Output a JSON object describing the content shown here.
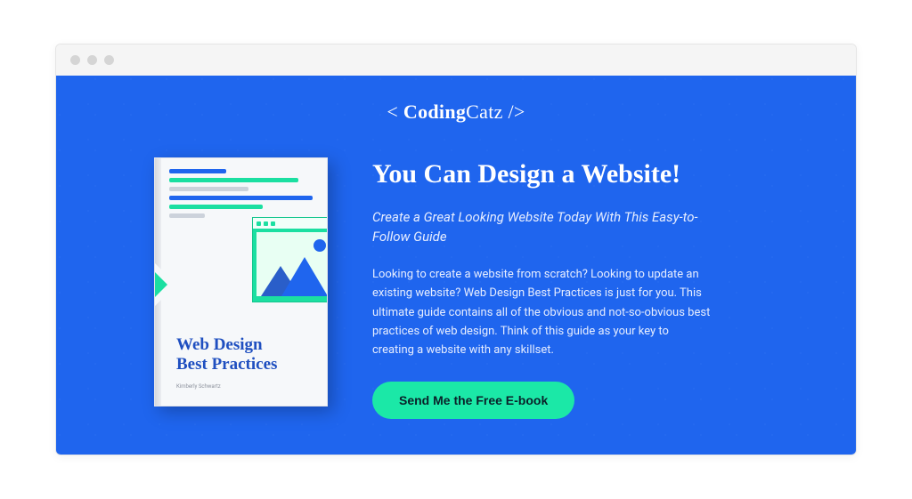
{
  "brand": {
    "prefix": "<",
    "name1": "Coding",
    "name2": "Catz",
    "suffix": "/>"
  },
  "book": {
    "title_line1": "Web Design",
    "title_line2": "Best Practices",
    "author": "Kimberly Schwartz"
  },
  "hero": {
    "headline": "You Can Design a Website!",
    "subhead": "Create a Great Looking Website Today With This Easy-to-Follow Guide",
    "body": "Looking to create a website from scratch? Looking to update an existing website? Web Design Best Practices is just for you. This ultimate guide contains all of the obvious and not-so-obvious best practices of web design. Think of this guide as your key to creating a website with any skillset.",
    "cta_label": "Send Me the Free E-book"
  },
  "colors": {
    "primary": "#1f65ee",
    "accent": "#1be8a7"
  }
}
